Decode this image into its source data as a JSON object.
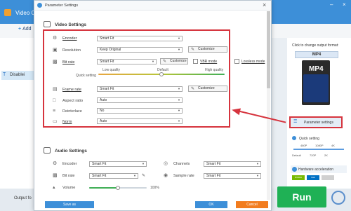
{
  "app": {
    "title": "Video Co",
    "add_label": "Add",
    "win_min": "–",
    "win_close": "×",
    "left_row_icon": "T",
    "left_row_label": "Disablei",
    "output_label": "Output fo",
    "right": {
      "click_change": "Click to change output format:",
      "format": "MP4",
      "format_badge": "MP4",
      "parameter_settings_label": "Parameter settings",
      "quick_setting_label": "Quick setting",
      "quick_ticks_top": [
        "480P",
        "1080P",
        "4K"
      ],
      "quick_ticks_bottom": [
        "Default",
        "720P",
        "2K"
      ],
      "hw_label": "Hardware acceleration",
      "gpu_labels": [
        "NVIDIA",
        "Intel",
        ""
      ],
      "run_label": "Run"
    }
  },
  "dialog": {
    "title": "Parameter Settings",
    "close": "×",
    "video": {
      "section_title": "Video Settings",
      "encoder": {
        "label": "Encoder",
        "value": "Smart Fit"
      },
      "resolution": {
        "label": "Resolution",
        "value": "Keep Original",
        "button": "Customize"
      },
      "bitrate": {
        "label": "Bit rate",
        "value": "Smart Fit",
        "button": "Customize",
        "vbr_label": "VBR mode",
        "lossless_label": "Lossless mode"
      },
      "quick": {
        "label": "Quick setting",
        "low": "Low quality",
        "default": "Default",
        "high": "High quality",
        "level": 0.5
      },
      "framerate": {
        "label": "Frame rate",
        "value": "Smart Fit",
        "button": "Customize"
      },
      "aspect": {
        "label": "Aspect ratio",
        "value": "Auto"
      },
      "deinterlace": {
        "label": "Deinterlace",
        "value": "No"
      },
      "norm": {
        "label": "Norm",
        "value": "Auto"
      }
    },
    "audio": {
      "section_title": "Audio Settings",
      "encoder": {
        "label": "Encoder",
        "value": "Smart Fit"
      },
      "channels": {
        "label": "Channels",
        "value": "Smart Fit"
      },
      "bitrate": {
        "label": "Bit rate",
        "value": "Smart Fit"
      },
      "samplerate": {
        "label": "Sample rate",
        "value": "Smart Fit"
      },
      "volume": {
        "label": "Volume",
        "value": "100%",
        "level": 0.5
      }
    },
    "footer": {
      "save_as": "Save as",
      "ok": "OK",
      "cancel": "Cancel"
    }
  },
  "colors": {
    "accent": "#3d8fd8",
    "highlight": "#d6343e",
    "run": "#1fb155",
    "ok": "#3d8fd8",
    "cancel": "#f27c1e"
  }
}
